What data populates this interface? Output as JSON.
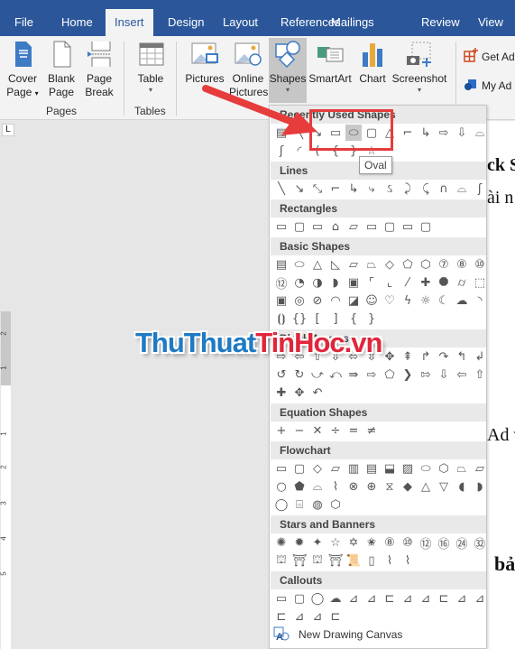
{
  "tabs": [
    {
      "label": "File",
      "active": false
    },
    {
      "label": "Home",
      "active": false
    },
    {
      "label": "Insert",
      "active": true
    },
    {
      "label": "Design",
      "active": false
    },
    {
      "label": "Layout",
      "active": false
    },
    {
      "label": "References",
      "active": false
    },
    {
      "label": "Mailings",
      "active": false
    },
    {
      "label": "Review",
      "active": false
    },
    {
      "label": "View",
      "active": false
    }
  ],
  "ribbon": {
    "pages": {
      "cover_page": "Cover Page",
      "cover_l1": "Cover",
      "cover_l2": "Page",
      "blank_l1": "Blank",
      "blank_l2": "Page",
      "break_l1": "Page",
      "break_l2": "Break",
      "group": "Pages"
    },
    "tables": {
      "table": "Table",
      "group": "Tables"
    },
    "illustrations": {
      "pictures": "Pictures",
      "online_l1": "Online",
      "online_l2": "Pictures",
      "shapes": "Shapes",
      "smartart": "SmartArt",
      "chart": "Chart",
      "screenshot": "Screenshot"
    },
    "addins": {
      "get": "Get Ad",
      "my": "My Ad"
    }
  },
  "shapes_menu": {
    "sections": [
      "Recently Used Shapes",
      "Lines",
      "Rectangles",
      "Basic Shapes",
      "Block Arrows",
      "Equation Shapes",
      "Flowchart",
      "Stars and Banners",
      "Callouts"
    ],
    "recent_row1": [
      "▤",
      "╲",
      "↘",
      "▭",
      "⬭",
      "▢",
      "△",
      "⌐",
      "↳",
      "⇨",
      "⇩",
      "⌓"
    ],
    "recent_row2": [
      "ʃ",
      "◜",
      "(",
      "{",
      "}",
      "☆"
    ],
    "lines": [
      "╲",
      "↘",
      "⤡",
      "⌐",
      "↳",
      "⤷",
      "ઽ",
      "⤸",
      "⤹",
      "∩",
      "⌓",
      "ʃ"
    ],
    "rectangles": [
      "▭",
      "▢",
      "▭",
      "⌂",
      "▱",
      "▭",
      "▢",
      "▭",
      "▢"
    ],
    "basic_row1": [
      "▤",
      "⬭",
      "△",
      "◺",
      "▱",
      "⏢",
      "◇",
      "⬠",
      "⬡",
      "⑦",
      "⑧",
      "⑩"
    ],
    "basic_row2": [
      "⑫",
      "◔",
      "◑",
      "◗",
      "▣",
      "⌜",
      "⌞",
      "⁄",
      "✚",
      "⯃",
      "⌭",
      "⬚"
    ],
    "basic_row3": [
      "▣",
      "◎",
      "⊘",
      "◠",
      "◪",
      "☺",
      "♡",
      "ϟ",
      "☼",
      "☾",
      "☁",
      "◝"
    ],
    "basic_row4": [
      "⦗⦘",
      "{}",
      "[",
      "]",
      "{",
      "}"
    ],
    "arrows_row1": [
      "⇨",
      "⇦",
      "⇧",
      "⇩",
      "⬄",
      "⇳",
      "✥",
      "⇞",
      "↱",
      "↷",
      "↰",
      "↲"
    ],
    "arrows_row2": [
      "↺",
      "↻",
      "⤻",
      "⤺",
      "⇛",
      "⇨",
      "⬠",
      "❯",
      "⇰",
      "⇩",
      "⇦",
      "⇧"
    ],
    "arrows_row3": [
      "✚",
      "✥",
      "↶"
    ],
    "equation": [
      "+",
      "−",
      "✕",
      "÷",
      "=",
      "≠"
    ],
    "flow_row1": [
      "▭",
      "▢",
      "◇",
      "▱",
      "▥",
      "▤",
      "⬓",
      "▨",
      "⬭",
      "⬡",
      "⏢",
      "⏥"
    ],
    "flow_row2": [
      "○",
      "⬟",
      "⌓",
      "⌇",
      "⊗",
      "⊕",
      "⧖",
      "◆",
      "△",
      "▽",
      "◖",
      "◗"
    ],
    "flow_row3": [
      "◯",
      "⌸",
      "◍",
      "⬡"
    ],
    "stars_row1": [
      "✺",
      "✹",
      "✦",
      "☆",
      "✡",
      "✬",
      "⑧",
      "⑩",
      "⑫",
      "⑯",
      "㉔",
      "㉜"
    ],
    "stars_row2": [
      "⛫",
      "⛩",
      "⛫",
      "⛩",
      "📜",
      "▯",
      "⌇",
      "⌇"
    ],
    "callouts_row1": [
      "▭",
      "▢",
      "◯",
      "☁",
      "⊿",
      "⊿",
      "⊏",
      "⊿",
      "⊿",
      "⊏",
      "⊿",
      "⊿"
    ],
    "callouts_row2": [
      "⊏",
      "⊿",
      "⊿",
      "⊏"
    ],
    "new_canvas": "New Drawing Canvas",
    "tooltip": "Oval"
  },
  "document": {
    "frag1": "ck S",
    "frag2": "ài n",
    "frag3": "Ad v",
    "frag4": "bả"
  },
  "watermark": {
    "part1": "ThuThuat",
    "part2": "TinHoc.vn"
  },
  "ruler": {
    "corner": "L",
    "marks": [
      "2",
      "1",
      "1",
      "2",
      "3",
      "4",
      "5"
    ]
  }
}
